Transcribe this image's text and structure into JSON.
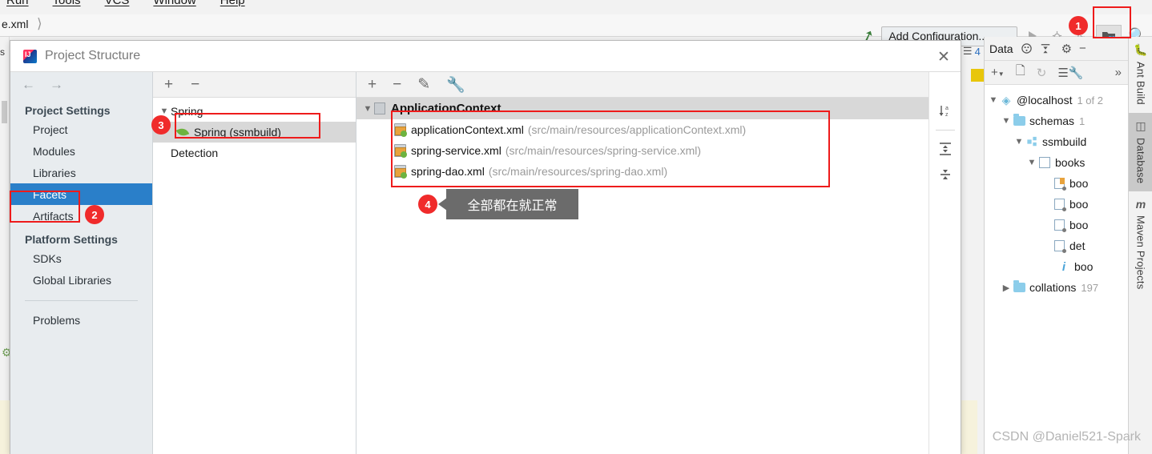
{
  "ide": {
    "menu_items": [
      "Run",
      "Tools",
      "VCS",
      "Window",
      "Help"
    ],
    "breadcrumb": "e.xml",
    "toolbar": {
      "hammer_icon": "hammer-icon",
      "add_configuration": "Add Configuration...",
      "run_icon": "run-icon",
      "debug_icon": "debug-icon",
      "rerun_icon": "rerun-icon",
      "project_structure_icon": "project-structure-icon",
      "search_icon": "search-icon"
    },
    "bg_tab_count": "4"
  },
  "markers": {
    "m1": "1",
    "m2": "2",
    "m3": "3",
    "m4": "4"
  },
  "dialog": {
    "title": "Project Structure",
    "logo_icon": "intellij-logo-icon",
    "close_icon": "close-icon",
    "nav": {
      "back_icon": "arrow-left-icon",
      "forward_icon": "arrow-right-icon"
    },
    "sidebar": {
      "groups": [
        {
          "label": "Project Settings",
          "items": [
            "Project",
            "Modules",
            "Libraries",
            "Facets",
            "Artifacts"
          ]
        },
        {
          "label": "Platform Settings",
          "items": [
            "SDKs",
            "Global Libraries"
          ]
        }
      ],
      "selected": "Facets",
      "footer_item": "Problems"
    },
    "middle": {
      "toolbar": {
        "add_icon": "plus-icon",
        "remove_icon": "minus-icon"
      },
      "tree": {
        "root": "Spring",
        "root_chevron": "chevron-down-icon",
        "child": "Spring (ssmbuild)",
        "child_icon": "spring-leaf-icon",
        "sibling": "Detection"
      }
    },
    "right": {
      "toolbar": {
        "add_icon": "plus-icon",
        "remove_icon": "minus-icon",
        "edit_icon": "pencil-icon",
        "settings_icon": "wrench-icon"
      },
      "context_node": {
        "label": "ApplicationContext",
        "chevron": "chevron-down-icon",
        "icon": "application-context-icon"
      },
      "files": [
        {
          "name": "applicationContext.xml",
          "path": "(src/main/resources/applicationContext.xml)",
          "icon": "xml-file-icon"
        },
        {
          "name": "spring-service.xml",
          "path": "(src/main/resources/spring-service.xml)",
          "icon": "xml-file-icon"
        },
        {
          "name": "spring-dao.xml",
          "path": "(src/main/resources/spring-dao.xml)",
          "icon": "xml-file-icon"
        }
      ],
      "side_tools": {
        "sort_icon": "sort-alpha-icon",
        "expand_all_icon": "expand-all-icon",
        "collapse_all_icon": "collapse-all-icon"
      }
    },
    "tooltip": "全部都在就正常"
  },
  "database_panel": {
    "header": {
      "title": "Data",
      "target_icon": "target-icon",
      "collapse_icon": "collapse-icon",
      "settings_icon": "gear-icon",
      "hide_icon": "minimize-icon"
    },
    "toolbar": {
      "add_icon": "plus-dropdown-icon",
      "copy_icon": "copy-icon",
      "refresh_icon": "refresh-icon",
      "console_icon": "query-console-icon",
      "more_icon": "chevron-double-right-icon"
    },
    "tree": [
      {
        "label": "@localhost",
        "count": "1 of 2",
        "icon": "datasource-icon",
        "chevron": "chevron-down-icon",
        "indent": 0
      },
      {
        "label": "schemas",
        "count": "1",
        "icon": "folder-icon",
        "chevron": "chevron-down-icon",
        "indent": 1
      },
      {
        "label": "ssmbuild",
        "count": "",
        "icon": "schema-icon",
        "chevron": "chevron-down-icon",
        "indent": 2
      },
      {
        "label": "books",
        "count": "",
        "icon": "table-icon",
        "chevron": "chevron-down-icon",
        "indent": 3
      },
      {
        "label": "boo",
        "count": "",
        "icon": "column-key-icon",
        "chevron": "",
        "indent": 4
      },
      {
        "label": "boo",
        "count": "",
        "icon": "column-icon",
        "chevron": "",
        "indent": 4
      },
      {
        "label": "boo",
        "count": "",
        "icon": "column-icon",
        "chevron": "",
        "indent": 4
      },
      {
        "label": "det",
        "count": "",
        "icon": "column-icon",
        "chevron": "",
        "indent": 4
      },
      {
        "label": "boo",
        "count": "",
        "icon": "index-info-icon",
        "chevron": "",
        "indent": 4
      },
      {
        "label": "collations",
        "count": "197",
        "icon": "folder-icon",
        "chevron": "chevron-right-icon",
        "indent": 1
      }
    ]
  },
  "vertical_tabs": [
    {
      "label": "Ant Build",
      "icon": "ant-icon",
      "active": false
    },
    {
      "label": "Database",
      "icon": "database-icon",
      "active": true
    },
    {
      "label": "Maven Projects",
      "icon": "maven-icon",
      "active": false
    }
  ],
  "watermark": "CSDN @Daniel521-Spark"
}
